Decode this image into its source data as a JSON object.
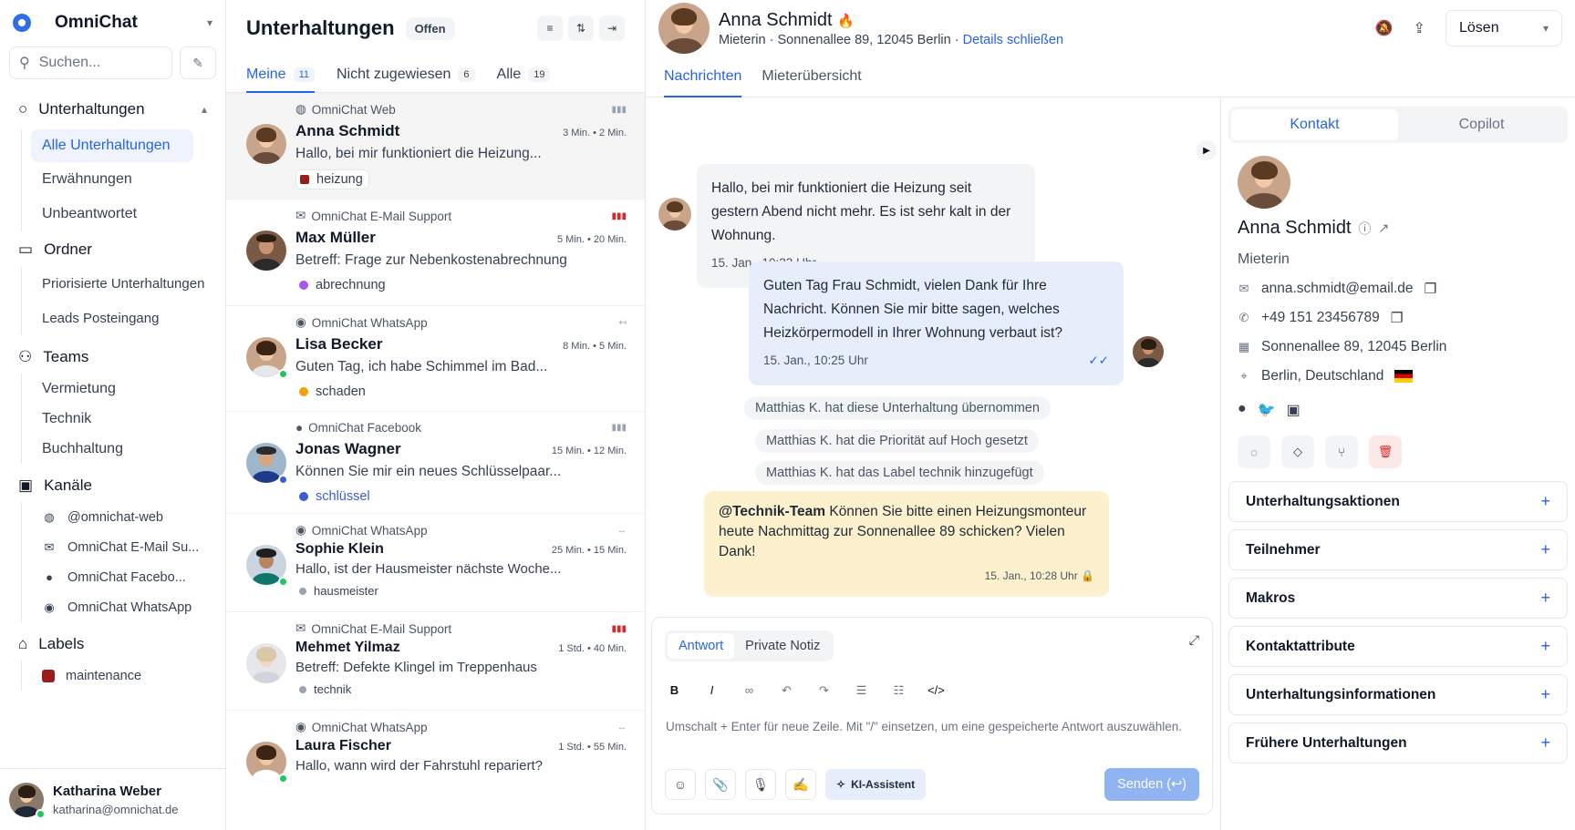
{
  "sidebar": {
    "app_name": "OmniChat",
    "search_placeholder": "Suchen...",
    "sections": {
      "conversations": "Unterhaltungen",
      "folders": "Ordner",
      "teams": "Teams",
      "channels": "Kanäle",
      "labels": "Labels"
    },
    "conversation_items": [
      "Alle Unterhaltungen",
      "Erwähnungen",
      "Unbeantwortet"
    ],
    "folder_items": [
      "Priorisierte Unterhaltungen",
      "Leads Posteingang"
    ],
    "team_items": [
      "Vermietung",
      "Technik",
      "Buchhaltung"
    ],
    "channel_items": [
      "@omnichat-web",
      "OmniChat E-Mail Su...",
      "OmniChat Facebo...",
      "OmniChat WhatsApp"
    ],
    "label_items": [
      "maintenance"
    ],
    "user": {
      "name": "Katharina Weber",
      "email": "katharina@omnichat.de"
    }
  },
  "convlist": {
    "title": "Unterhaltungen",
    "status": "Offen",
    "tabs": [
      {
        "label": "Meine",
        "count": "11"
      },
      {
        "label": "Nicht zugewiesen",
        "count": "6"
      },
      {
        "label": "Alle",
        "count": "19"
      }
    ],
    "items": [
      {
        "inbox": "OmniChat Web",
        "name": "Anna Schmidt",
        "times": "3 Min. • 2 Min.",
        "preview": "Hallo, bei mir funktioniert die Heizung...",
        "tag": "heizung",
        "tag_color": "#9b1c1c"
      },
      {
        "inbox": "OmniChat E-Mail Support",
        "name": "Max Müller",
        "times": "5 Min. • 20 Min.",
        "preview": "Betreff: Frage zur Nebenkostenabrechnung",
        "tag": "abrechnung",
        "tag_color": "#a855f7"
      },
      {
        "inbox": "OmniChat WhatsApp",
        "name": "Lisa Becker",
        "times": "8 Min. • 5 Min.",
        "preview": "Guten Tag, ich habe Schimmel im Bad...",
        "tag": "schaden",
        "tag_color": "#f59e0b"
      },
      {
        "inbox": "OmniChat Facebook",
        "name": "Jonas Wagner",
        "times": "15 Min. • 12 Min.",
        "preview": "Können Sie mir ein neues Schlüsselpaar...",
        "tag": "schlüssel",
        "tag_color": "#3b5bdb"
      },
      {
        "inbox": "OmniChat WhatsApp",
        "name": "Sophie Klein",
        "times": "25 Min. • 15 Min.",
        "preview": "Hallo, ist der Hausmeister nächste Woche...",
        "tag": "hausmeister",
        "tag_color": "#9ca3af"
      },
      {
        "inbox": "OmniChat E-Mail Support",
        "name": "Mehmet Yilmaz",
        "times": "1 Std. • 40 Min.",
        "preview": "Betreff: Defekte Klingel im Treppenhaus",
        "tag": "technik",
        "tag_color": "#9ca3af"
      },
      {
        "inbox": "OmniChat WhatsApp",
        "name": "Laura Fischer",
        "times": "1 Std. • 55 Min.",
        "preview": "Hallo, wann wird der Fahrstuhl repariert?",
        "tag": "",
        "tag_color": ""
      }
    ]
  },
  "chat": {
    "name": "Anna Schmidt",
    "subtitle": "Mieterin · Sonnenallee 89, 12045 Berlin ·",
    "details_link": "Details schließen",
    "resolve_label": "Lösen",
    "tabs": [
      "Nachrichten",
      "Mieterübersicht"
    ],
    "msg1": {
      "text": "Hallo, bei mir funktioniert die Heizung seit gestern Abend nicht mehr. Es ist sehr kalt in der Wohnung.",
      "time": "15. Jan., 10:23 Uhr"
    },
    "msg2": {
      "text": "Guten Tag Frau Schmidt, vielen Dank für Ihre Nachricht. Können Sie mir bitte sagen, welches Heizkörpermodell in Ihrer Wohnung verbaut ist?",
      "time": "15. Jan., 10:25 Uhr"
    },
    "activities": [
      "Matthias K. hat diese Unterhaltung übernommen",
      "Matthias K. hat die Priorität auf Hoch gesetzt",
      "Matthias K. hat das Label technik hinzugefügt"
    ],
    "note": {
      "mention": "@Technik-Team",
      "text": " Können Sie bitte einen Heizungsmonteur heute Nachmittag zur Sonnenallee 89 schicken? Vielen Dank!",
      "time": "15. Jan., 10:28 Uhr"
    },
    "composer": {
      "tab_reply": "Antwort",
      "tab_note": "Private Notiz",
      "placeholder": "Umschalt + Enter für neue Zeile. Mit \"/\" einsetzen, um eine gespeicherte Antwort auszuwählen.",
      "ai_label": "KI-Assistent",
      "send_label": "Senden (↩)"
    }
  },
  "contact": {
    "tabs": [
      "Kontakt",
      "Copilot"
    ],
    "name": "Anna Schmidt",
    "role": "Mieterin",
    "email": "anna.schmidt@email.de",
    "phone": "+49 151 23456789",
    "address": "Sonnenallee 89, 12045 Berlin",
    "location": "Berlin, Deutschland",
    "accordions": [
      "Unterhaltungsaktionen",
      "Teilnehmer",
      "Makros",
      "Kontaktattribute",
      "Unterhaltungsinformationen",
      "Frühere Unterhaltungen"
    ]
  }
}
